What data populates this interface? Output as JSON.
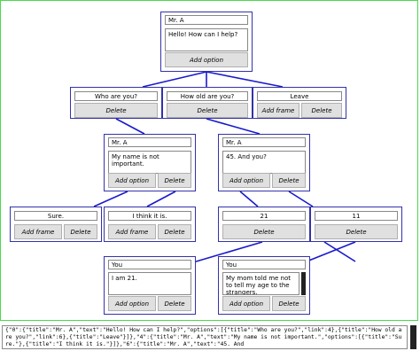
{
  "node0": {
    "title": "Mr. A",
    "text": "Hello! How can I help?",
    "add_option_label": "Add option"
  },
  "opt_who": {
    "text": "Who are you?",
    "delete_label": "Delete"
  },
  "opt_old": {
    "text": "How old are you?",
    "delete_label": "Delete"
  },
  "opt_leave": {
    "text": "Leave",
    "add_frame_label": "Add frame",
    "delete_label": "Delete"
  },
  "node4": {
    "title": "Mr. A",
    "text": "My name is not important.",
    "add_option_label": "Add option",
    "delete_label": "Delete"
  },
  "node6": {
    "title": "Mr. A",
    "text": "45. And you?",
    "add_option_label": "Add option",
    "delete_label": "Delete"
  },
  "opt_sure": {
    "text": "Sure.",
    "add_frame_label": "Add frame",
    "delete_label": "Delete"
  },
  "opt_think": {
    "text": "I think it is.",
    "add_frame_label": "Add frame",
    "delete_label": "Delete"
  },
  "opt_21": {
    "text": "21",
    "delete_label": "Delete"
  },
  "opt_11": {
    "text": "11",
    "delete_label": "Delete"
  },
  "node_you1": {
    "title": "You",
    "text": "I am 21.",
    "add_option_label": "Add option",
    "delete_label": "Delete"
  },
  "node_you2": {
    "title": "You",
    "text": "My mom told me not to tell my age to the strangers.",
    "add_option_label": "Add option",
    "delete_label": "Delete"
  },
  "json_output": "{\"0\":{\"title\":\"Mr. A\",\"text\":\"Hello! How can I help?\",\"options\":[{\"title\":\"Who are you?\",\"link\":4},{\"title\":\"How old are you?\",\"link\":6},{\"title\":\"Leave\"}]},\"4\":{\"title\":\"Mr. A\",\"text\":\"My name is not important.\",\"options\":[{\"title\":\"Sure.\"},{\"title\":\"I think it is.\"}]},\"6\":{\"title\":\"Mr. A\",\"text\":\"45. And",
  "colors": {
    "border": "#3333aa",
    "line": "#1a1acc",
    "canvas_border": "#4cd94c",
    "button": "#e0e0e0"
  }
}
